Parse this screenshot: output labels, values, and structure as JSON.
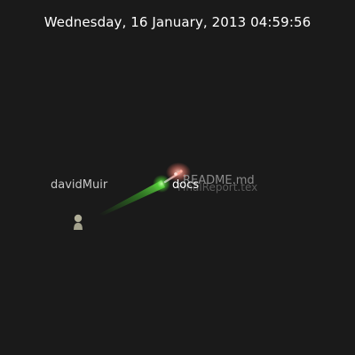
{
  "timestamp": "Wednesday, 16 January, 2013 04:59:56",
  "user": {
    "name": "davidMuir",
    "icon": "person-avatar-icon",
    "color": "#b0ae98"
  },
  "directories": [
    {
      "name": "docs"
    }
  ],
  "files": [
    {
      "name": "README.md",
      "color": "#ff7a66"
    },
    {
      "name": "FinalReport.tex",
      "color": "#8c8c8c"
    }
  ],
  "colors": {
    "background": "#1a1a1a",
    "beam": "#4bd22f",
    "highlight": "#ffffff"
  }
}
